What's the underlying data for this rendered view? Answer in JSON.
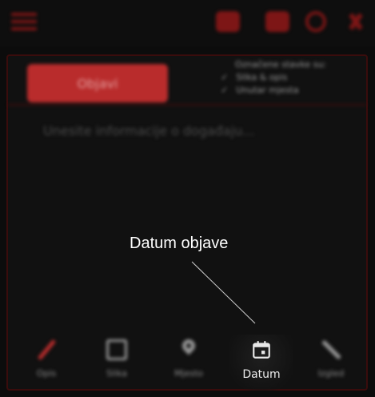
{
  "toolbar": {
    "menu_icon": "menu-icon",
    "icons": [
      "video-icon",
      "camera-icon",
      "refresh-icon",
      "people-icon"
    ]
  },
  "composer": {
    "publish_label": "Objavi",
    "options_heading": "Označene stavke su:",
    "options": [
      "Slika & opis",
      "Unutar mjesta"
    ],
    "placeholder": "Unesite informacije o događaju..."
  },
  "bottom_nav": {
    "items": [
      {
        "label": "Opis",
        "icon": "pencil-icon"
      },
      {
        "label": "Slika",
        "icon": "image-icon"
      },
      {
        "label": "Mjesto",
        "icon": "location-pin-icon"
      },
      {
        "label": "Datum",
        "icon": "calendar-icon",
        "active": true
      },
      {
        "label": "Izgled",
        "icon": "wrench-icon"
      }
    ]
  },
  "annotation": {
    "label": "Datum objave"
  },
  "colors": {
    "background": "#0c0c0c",
    "accent": "#b92c2c",
    "accent_dark": "#7d1616",
    "label": "#8c8c8c",
    "active_label": "#ececec"
  }
}
